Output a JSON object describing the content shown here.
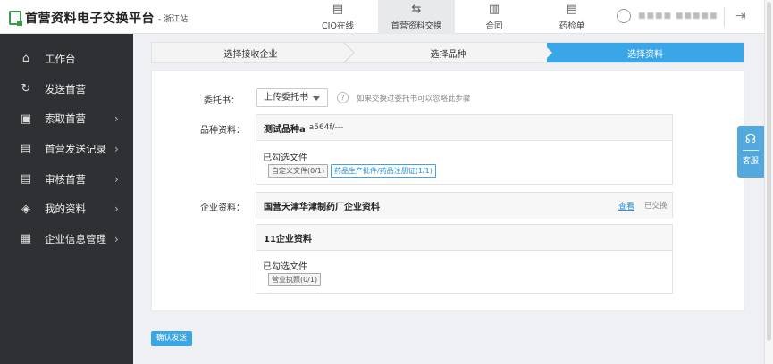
{
  "header": {
    "title": "首营资料电子交换平台",
    "subtitle": "- 浙江站",
    "nav": [
      {
        "label": "CIO在线",
        "icon": "document-icon"
      },
      {
        "label": "首营资料交换",
        "icon": "exchange-icon",
        "active": true
      },
      {
        "label": "合同",
        "icon": "contract-icon"
      },
      {
        "label": "药检单",
        "icon": "report-icon"
      }
    ],
    "user_name": "■■■■ ■■■■■"
  },
  "sidebar": {
    "items": [
      {
        "label": "工作台",
        "icon": "home-icon",
        "arrow": false
      },
      {
        "label": "发送首营",
        "icon": "send-icon",
        "arrow": false
      },
      {
        "label": "索取首营",
        "icon": "request-icon",
        "arrow": true
      },
      {
        "label": "首营发送记录",
        "icon": "record-icon",
        "arrow": true
      },
      {
        "label": "审核首营",
        "icon": "review-icon",
        "arrow": true
      },
      {
        "label": "我的资料",
        "icon": "layers-icon",
        "arrow": true
      },
      {
        "label": "企业信息管理",
        "icon": "company-icon",
        "arrow": true
      }
    ]
  },
  "steps": [
    "选择接收企业",
    "选择品种",
    "选择资料"
  ],
  "form": {
    "entrust_label": "委托书：",
    "entrust_value": "上传委托书",
    "entrust_hint": "如果交换过委托书可以忽略此步骤",
    "product_label": "品种资料：",
    "product_name": "测试品种a",
    "product_spec": "a564f/---",
    "selected_files_label": "已勾选文件",
    "product_tags": [
      {
        "label": "自定义文件(0/1)",
        "style": "gray"
      },
      {
        "label": "药品生产批件/药品注册证(1/1)",
        "style": "blue"
      }
    ],
    "company_label": "企业资料：",
    "company_name": "国营天津华津制药厂企业资料",
    "company_view": "查看",
    "company_status": "已交换",
    "sub_company_name": "11企业资料",
    "sub_selected_files_label": "已勾选文件",
    "sub_tags": [
      {
        "label": "营业执照(0/1)",
        "style": "gray"
      }
    ]
  },
  "confirm_button": "确认发送",
  "service": {
    "label": "客服",
    "icon": "headset-icon"
  },
  "colors": {
    "accent": "#3aa6e8",
    "sidebar_bg": "#2e3033",
    "logo_green": "#3a9a4a"
  }
}
